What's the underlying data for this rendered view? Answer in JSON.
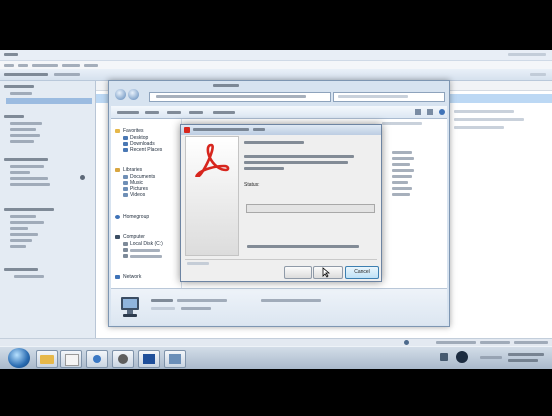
{
  "explorer": {
    "nav": [
      {
        "label": "Favorites"
      },
      {
        "label": "Desktop"
      },
      {
        "label": "Downloads"
      },
      {
        "label": "Recent Places"
      },
      {
        "label": "Libraries"
      },
      {
        "label": "Documents"
      },
      {
        "label": "Music"
      },
      {
        "label": "Pictures"
      },
      {
        "label": "Videos"
      },
      {
        "label": "Homegroup"
      },
      {
        "label": "Computer"
      },
      {
        "label": "Local Disk (C:)"
      },
      {
        "label": "Network"
      }
    ]
  },
  "dialog": {
    "status_label": "Status:",
    "cancel_label": "Cancel"
  },
  "colors": {
    "adobe_red": "#d7261e",
    "selection": "#bcd8f4",
    "taskbar": "#a9b9cb"
  },
  "icons": [
    "adobe-reader-logo-icon",
    "start-orb-icon",
    "folder-icon",
    "computer-icon"
  ]
}
